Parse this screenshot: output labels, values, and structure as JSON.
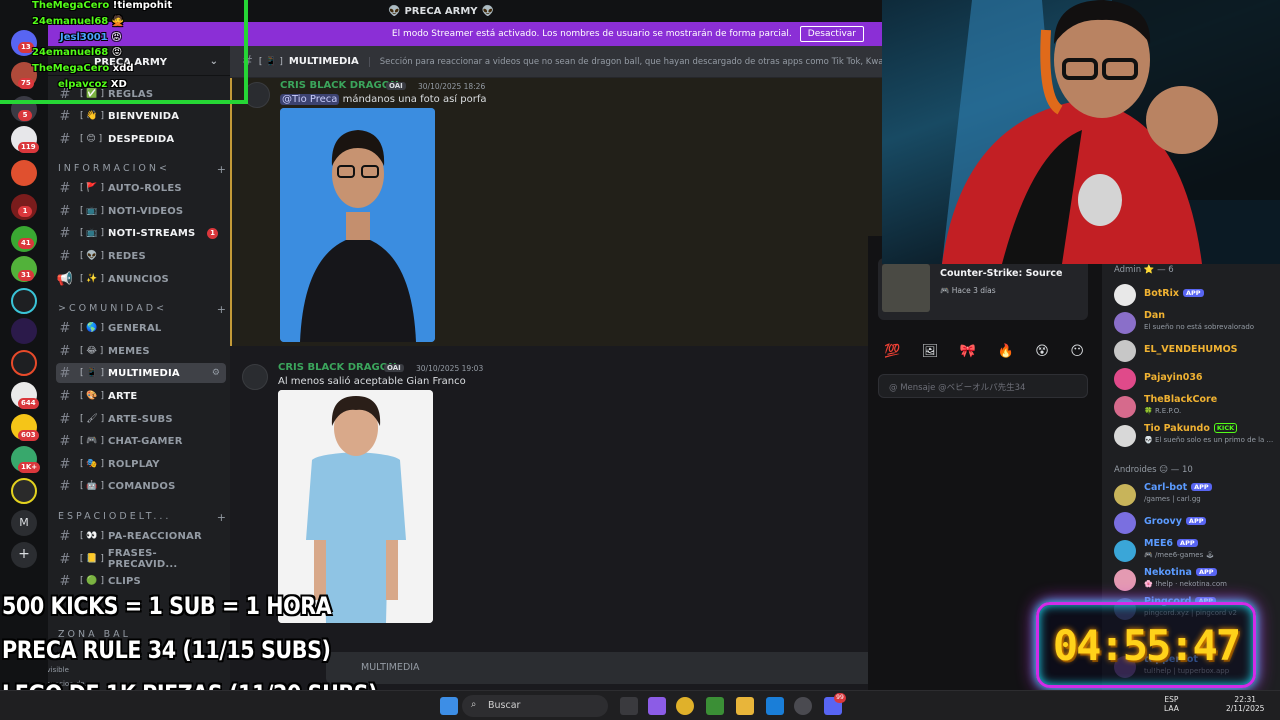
{
  "topbar": {
    "server_title": "PRECA ARMY",
    "left_emoji": "👽",
    "right_emoji": "👽"
  },
  "streamer_banner": {
    "text": "El modo Streamer está activado. Los nombres de usuario se mostrarán de forma parcial.",
    "button": "Desactivar"
  },
  "guild_badges": [
    "13",
    "75",
    "5",
    "119",
    "1",
    "41",
    "31",
    "644",
    "603",
    "1K+"
  ],
  "sidebar": {
    "server_name": "PRECA ARMY",
    "channels_top": [
      {
        "emoji": "[ ✅ ]",
        "label": "REGLAS"
      },
      {
        "emoji": "[ 👋 ]",
        "label": "BIENVENIDA"
      },
      {
        "emoji": "[ 😊 ]",
        "label": "DESPEDIDA"
      }
    ],
    "cat_info": "INFORMACION<",
    "channels_info": [
      {
        "emoji": "[ 🚩 ]",
        "label": "AUTO-ROLES"
      },
      {
        "emoji": "[ 📺 ]",
        "label": "NOTI-VIDEOS"
      },
      {
        "emoji": "[ 📺 ]",
        "label": "NOTI-STREAMS",
        "badge": "1"
      },
      {
        "emoji": "[ 👽 ]",
        "label": "REDES"
      },
      {
        "emoji": "[ ✨ ]",
        "label": "ANUNCIOS"
      }
    ],
    "cat_comunidad": ">COMUNIDAD<",
    "channels_comunidad": [
      {
        "emoji": "[ 🌎 ]",
        "label": "GENERAL"
      },
      {
        "emoji": "[ 😂 ]",
        "label": "MEMES"
      },
      {
        "emoji": "[ 📱 ]",
        "label": "MULTIMEDIA"
      },
      {
        "emoji": "[ 🎨 ]",
        "label": "ARTE"
      },
      {
        "emoji": "[ 🖌 ]",
        "label": "ARTE-SUBS"
      },
      {
        "emoji": "[ 🎮 ]",
        "label": "CHAT-GAMER"
      },
      {
        "emoji": "[ 🎭 ]",
        "label": "ROLPLAY"
      },
      {
        "emoji": "[ 🤖 ]",
        "label": "COMANDOS"
      }
    ],
    "cat_espacio": "ESPACIODELT...",
    "channels_espacio": [
      {
        "emoji": "[ 👀 ]",
        "label": "PA-REACCIONAR"
      },
      {
        "emoji": "[ 📒 ]",
        "label": "FRASES-PRECAVID..."
      },
      {
        "emoji": "[ 🟢 ]",
        "label": "CLIPS"
      }
    ],
    "cat_zona": "ZONA BAL",
    "invisible": "Invisible",
    "footer_status": "Funcuacion de..."
  },
  "channel_header": {
    "name": "MULTIMEDIA",
    "topic": "Sección para reaccionar a videos que no sean de dragon ball, que hayan descargado de otras apps como Tik Tok, Kwai, Youtube"
  },
  "messages": [
    {
      "author": "CRIS BLACK DRAGON",
      "tag": "OAI",
      "time": "30/10/2025 18:26",
      "mention": "@Tio Preca",
      "text": " mándanos una foto así porfa"
    },
    {
      "author": "CRIS BLACK DRAGON",
      "tag": "OAI",
      "time": "30/10/2025 19:03",
      "text": "Al menos salió aceptable Gian Franco"
    }
  ],
  "composer": {
    "placeholder": "MULTIMEDIA"
  },
  "dm_panel": {
    "activity_title": "Counter-Strike: Source",
    "activity_time": "Hace 3 días",
    "reactions": [
      "💯",
      "🖼",
      "🎀",
      "🔥",
      "😵",
      "😶"
    ],
    "message_placeholder": "Mensaje @ベビーオルパ先生34"
  },
  "members": {
    "admin_header": "Admin ⭐ — 6",
    "admins": [
      {
        "name": "BotRix",
        "badge": "APP",
        "color": "#f0b232",
        "sub": ""
      },
      {
        "name": "Dan",
        "color": "#f0b232",
        "sub": "El sueño no está sobrevalorado"
      },
      {
        "name": "EL_VENDEHUMOS",
        "color": "#f0b232",
        "sub": ""
      },
      {
        "name": "Pajayin036",
        "color": "#f0b232",
        "sub": ""
      },
      {
        "name": "TheBlackCore",
        "color": "#f0b232",
        "sub": "🍀 R.E.P.O."
      },
      {
        "name": "Tio Pakundo",
        "badge": "KICK",
        "color": "#f0b232",
        "sub": "💀 El sueño solo es un primo de la ..."
      }
    ],
    "androids_header": "Androides 😑 — 10",
    "androids": [
      {
        "name": "Carl-bot",
        "badge": "APP",
        "color": "#5b9bff",
        "sub": "/games | carl.gg"
      },
      {
        "name": "Groovy",
        "badge": "APP",
        "color": "#5b9bff",
        "sub": ""
      },
      {
        "name": "MEE6",
        "badge": "APP",
        "color": "#5b9bff",
        "sub": "🎮 /mee6-games 🕹"
      },
      {
        "name": "Nekotina",
        "badge": "APP",
        "color": "#5b9bff",
        "sub": "🌸 !help · nekotina.com"
      },
      {
        "name": "Pingcord",
        "badge": "APP",
        "color": "#5b9bff",
        "sub": "pingcord.xyz | pingcord v2"
      },
      {
        "name": "tupperbot",
        "badge": "APP",
        "color": "#5b9bff",
        "sub": "tul!help | tupperbox.app"
      }
    ]
  },
  "chat_overlay": [
    {
      "user": "TheMegaCero",
      "msg": "!tiempohit",
      "cls": "u"
    },
    {
      "user": "24emanuel68",
      "msg": "🙅",
      "cls": "u"
    },
    {
      "user": "Jesl3001",
      "msg": "😡",
      "cls": "u2"
    },
    {
      "user": "24emanuel68",
      "msg": "😡",
      "cls": "u"
    },
    {
      "user": "TheMegaCero",
      "msg": "xdd",
      "cls": "u"
    },
    {
      "user": "elpavcoz",
      "msg": "XD",
      "cls": "u"
    }
  ],
  "goals": [
    "500 KICKS = 1 SUB = 1 HORA",
    "PRECA RULE 34 (11/15 SUBS)",
    "LEGO DE 1K PIEZAS (11/20 SUBS)"
  ],
  "timer": "04:55:47",
  "taskbar": {
    "search": "Buscar",
    "lang1": "ESP",
    "lang2": "LAA",
    "time": "22:31",
    "date": "2/11/2025",
    "discord_badge": "99"
  }
}
